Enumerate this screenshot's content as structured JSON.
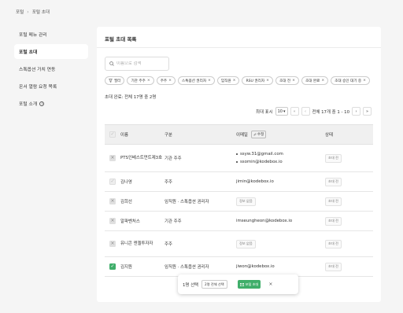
{
  "breadcrumb": {
    "root": "포털",
    "separator": "›",
    "current": "포털 초대"
  },
  "sidebar": {
    "items": [
      {
        "label": "포털 메뉴 관리",
        "active": false
      },
      {
        "label": "포털 초대",
        "active": true
      },
      {
        "label": "스톡옵션 가치 연동",
        "active": false
      },
      {
        "label": "온서 열람 요청 목록",
        "active": false
      },
      {
        "label": "포털 소개",
        "active": false,
        "icon": "info-circle-icon"
      }
    ]
  },
  "card": {
    "title": "포털 초대 목록",
    "search": {
      "placeholder": "이름으로 검색"
    },
    "filters": {
      "filter_label": "필터",
      "chips": [
        "기관 주주",
        "주주",
        "스톡옵션 권리자",
        "임직원",
        "RSU 권리자",
        "초대 전",
        "초대 완료",
        "초대 승인 대기 중"
      ]
    },
    "summary": "초대 완료: 전체 17명 중 2명",
    "pager": {
      "page_size_label": "최대 표시",
      "page_size": "10",
      "range": "전체 17개 중 1 - 10",
      "first": "«",
      "prev": "‹",
      "next": "›",
      "last": "»"
    },
    "table": {
      "headers": {
        "name": "이름",
        "type": "구분",
        "email": "이메일",
        "edit": "수정",
        "status": "상태"
      },
      "rows": [
        {
          "name": "PTS인베스트먼트제3호",
          "type": "기관 주주",
          "emails": [
            "ssyw.31@gmail.com",
            "ssomin@kodebox.io"
          ],
          "status": "초대 전",
          "check": "disabled"
        },
        {
          "name": "김나영",
          "type": "주주",
          "emails": [
            "jimin@kodebox.io"
          ],
          "status": "초대 전",
          "check": "light"
        },
        {
          "name": "김희선",
          "type": "임직원 · 스톡옵션 권리자",
          "emails": [],
          "email_badge": "정보 없음",
          "status": "초대 전",
          "check": "disabled"
        },
        {
          "name": "알파벤처스",
          "type": "기관 주주",
          "emails": [
            "imseungheon@kodebox.io"
          ],
          "status": "초대 전",
          "check": "disabled"
        },
        {
          "name": "유니콘 엔젤투자자",
          "type": "주주",
          "emails": [],
          "email_badge": "정보 없음",
          "status": "초대 전",
          "check": "disabled"
        },
        {
          "name": "김지원",
          "type": "임직원 · 스톡옵션 권리자",
          "emails": [
            "jiwon@kodebox.io"
          ],
          "status": "초대 전",
          "check": "checked"
        }
      ]
    }
  },
  "floatbar": {
    "selected": "1명 선택",
    "select_all": "2명 전체 선택",
    "invite": "포털 초대",
    "close": "×"
  },
  "colors": {
    "accent": "#3fae6a",
    "background": "#f5f5f5",
    "card": "#ffffff",
    "header_bg": "#f0f0f0"
  }
}
